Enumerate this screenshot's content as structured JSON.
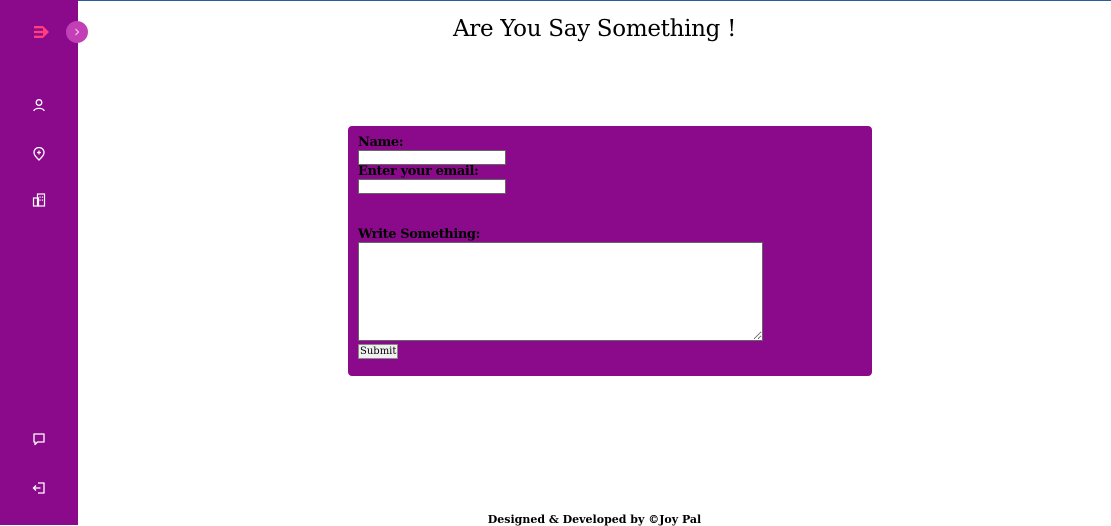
{
  "page": {
    "title": "Are You Say Something !"
  },
  "sidebar": {
    "items": [
      {
        "icon": "user-icon"
      },
      {
        "icon": "location-pin-icon"
      },
      {
        "icon": "building-icon"
      },
      {
        "icon": "message-icon"
      },
      {
        "icon": "logout-icon"
      }
    ],
    "toggle_icon": "chevron-right-icon",
    "logo_icon": "logo-icon"
  },
  "form": {
    "name_label": "Name:",
    "name_value": "",
    "email_label": "Enter your email:",
    "email_value": "",
    "message_label": "Write Something:",
    "message_value": "",
    "submit_label": "Submit"
  },
  "footer": {
    "text": "Designed & Developed by ©Joy Pal"
  },
  "colors": {
    "sidebar_bg": "#8b0a8b",
    "form_bg": "#8b0a8b",
    "logo": "#ff3d7f",
    "toggle_bg": "#c23fb6"
  }
}
